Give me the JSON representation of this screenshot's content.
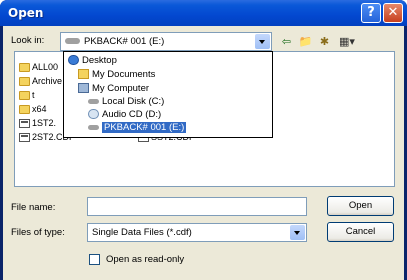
{
  "window": {
    "title": "Open",
    "help_label": "?",
    "close_label": "✕"
  },
  "look_in": {
    "label": "Look in:",
    "value": "PKBACK# 001 (E:)"
  },
  "toolbar": {
    "back_icon": "⇦",
    "up_icon": "📁",
    "new_folder_icon": "✱",
    "views_icon": "▦▾"
  },
  "files": [
    {
      "name": "ALL00",
      "type": "folder"
    },
    {
      "name": "Archive",
      "type": "folder"
    },
    {
      "name": "t",
      "type": "folder"
    },
    {
      "name": "x64",
      "type": "folder"
    },
    {
      "name": "1ST2.",
      "type": "cdf"
    },
    {
      "name": "2ST2.CDF",
      "type": "cdf"
    },
    {
      "name": "SST2.CDF",
      "type": "cdf"
    }
  ],
  "dropdown": {
    "items": [
      {
        "label": "Desktop",
        "icon": "desktop-icon"
      },
      {
        "label": "My Documents",
        "icon": "my-documents-icon"
      },
      {
        "label": "My Computer",
        "icon": "my-computer-icon"
      },
      {
        "label": "Local Disk (C:)",
        "icon": "hard-drive-icon"
      },
      {
        "label": "Audio CD (D:)",
        "icon": "cd-drive-icon"
      },
      {
        "label": "PKBACK# 001 (E:)",
        "icon": "removable-drive-icon"
      }
    ]
  },
  "file_name": {
    "label": "File name:",
    "value": ""
  },
  "file_type": {
    "label": "Files of type:",
    "value": "Single Data Files (*.cdf)"
  },
  "buttons": {
    "open": "Open",
    "cancel": "Cancel"
  },
  "read_only": {
    "label": "Open as read-only",
    "checked": false
  },
  "colors": {
    "title_bar": "#0348d0",
    "selection": "#316ac5",
    "dialog_face": "#ece9d8"
  }
}
